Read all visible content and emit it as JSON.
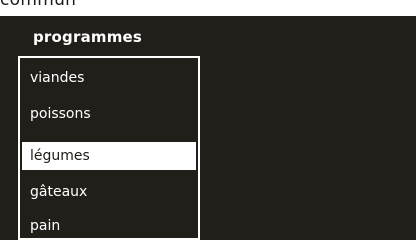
{
  "cropped_header": "commun",
  "panel": {
    "title": "programmes",
    "selected_index": 2,
    "items": [
      {
        "label": "viandes"
      },
      {
        "label": "poissons"
      },
      {
        "label": "légumes"
      },
      {
        "label": "gâteaux"
      },
      {
        "label": "pain"
      }
    ]
  },
  "colors": {
    "screen_background": "#221f1b",
    "text": "#ffffff",
    "selection_background": "#ffffff",
    "selection_text": "#1e1b17"
  }
}
